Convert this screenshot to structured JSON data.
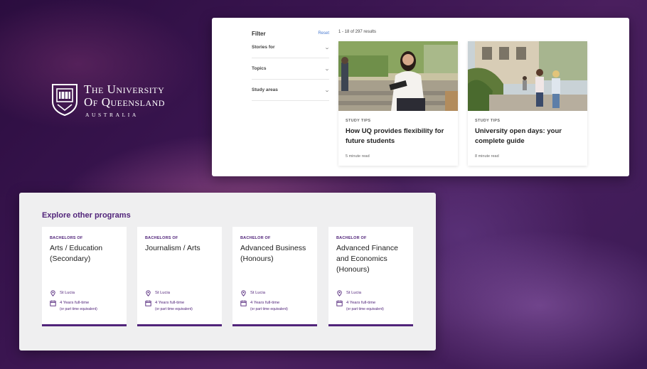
{
  "logo": {
    "line1": "The University",
    "line2": "Of Queensland",
    "line3": "AUSTRALIA"
  },
  "filter": {
    "title": "Filter",
    "reset_label": "Reset",
    "rows": [
      {
        "label": "Stories for"
      },
      {
        "label": "Topics"
      },
      {
        "label": "Study areas"
      }
    ]
  },
  "results": {
    "count_text": "1 - 18 of 297 results"
  },
  "stories": [
    {
      "tag": "STUDY TIPS",
      "title": "How UQ provides flexibility for future students",
      "read_time": "5 minute read"
    },
    {
      "tag": "STUDY TIPS",
      "title": "University open days: your complete guide",
      "read_time": "8 minute read"
    }
  ],
  "programs_section": {
    "title": "Explore other programs",
    "programs": [
      {
        "kicker": "BACHELORS OF",
        "name": "Arts / Education (Secondary)",
        "location": "St Lucia",
        "duration": "4 Years full-time",
        "duration_note": "(or part time equivalent)"
      },
      {
        "kicker": "BACHELORS OF",
        "name": "Journalism / Arts",
        "location": "St Lucia",
        "duration": "4 Years full-time",
        "duration_note": "(or part time equivalent)"
      },
      {
        "kicker": "BACHELOR OF",
        "name": "Advanced Business (Honours)",
        "location": "St Lucia",
        "duration": "4 Years full-time",
        "duration_note": "(or part time equivalent)"
      },
      {
        "kicker": "BACHELOR OF",
        "name": "Advanced Finance and Economics (Honours)",
        "location": "St Lucia",
        "duration": "4 Years full-time",
        "duration_note": "(or part time equivalent)"
      }
    ]
  },
  "colors": {
    "brand_purple": "#51247a",
    "link_blue": "#4a7bd0"
  }
}
